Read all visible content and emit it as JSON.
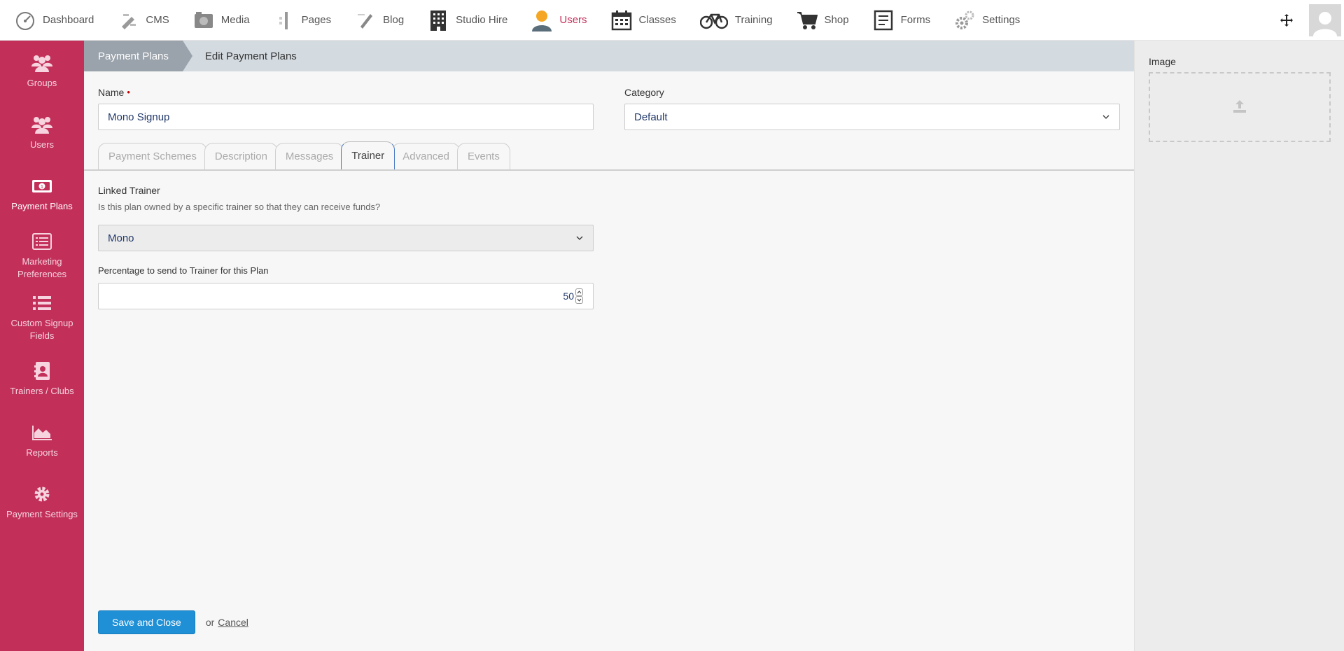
{
  "topnav": {
    "items": [
      {
        "label": "Dashboard",
        "icon": "dashboard-icon"
      },
      {
        "label": "CMS",
        "icon": "cms-icon"
      },
      {
        "label": "Media",
        "icon": "media-icon"
      },
      {
        "label": "Pages",
        "icon": "pages-icon"
      },
      {
        "label": "Blog",
        "icon": "blog-icon"
      },
      {
        "label": "Studio Hire",
        "icon": "building-icon"
      },
      {
        "label": "Users",
        "icon": "user-icon"
      },
      {
        "label": "Classes",
        "icon": "calendar-icon"
      },
      {
        "label": "Training",
        "icon": "bicycle-icon"
      },
      {
        "label": "Shop",
        "icon": "cart-icon"
      },
      {
        "label": "Forms",
        "icon": "form-icon"
      },
      {
        "label": "Settings",
        "icon": "gears-icon"
      }
    ],
    "active": "Users",
    "active_color": "#c2305a"
  },
  "sidebar": {
    "items": [
      {
        "label": "Groups",
        "icon": "group-icon"
      },
      {
        "label": "Users",
        "icon": "users-icon"
      },
      {
        "label": "Payment Plans",
        "icon": "money-icon"
      },
      {
        "label": "Marketing Preferences",
        "icon": "list-icon"
      },
      {
        "label": "Custom Signup Fields",
        "icon": "fields-icon"
      },
      {
        "label": "Trainers / Clubs",
        "icon": "contact-book-icon"
      },
      {
        "label": "Reports",
        "icon": "area-chart-icon"
      },
      {
        "label": "Payment Settings",
        "icon": "cog-icon"
      }
    ],
    "active": "Payment Plans",
    "color": "#c2305a"
  },
  "breadcrumb": {
    "parent": "Payment Plans",
    "current": "Edit Payment Plans"
  },
  "form": {
    "name_label": "Name",
    "required_mark": "•",
    "name_value": "Mono Signup",
    "category_label": "Category",
    "category_value": "Default",
    "tabs": [
      "Payment Schemes",
      "Description",
      "Messages",
      "Trainer",
      "Advanced",
      "Events"
    ],
    "active_tab": "Trainer",
    "linked_trainer_label": "Linked Trainer",
    "linked_trainer_help": "Is this plan owned by a specific trainer so that they can receive funds?",
    "linked_trainer_value": "Mono",
    "percentage_label": "Percentage to send to Trainer for this Plan",
    "percentage_value": "50"
  },
  "actions": {
    "save_label": "Save and Close",
    "or_text": "or",
    "cancel_label": "Cancel",
    "primary_color": "#1f8fd6"
  },
  "right_panel": {
    "image_label": "Image"
  }
}
